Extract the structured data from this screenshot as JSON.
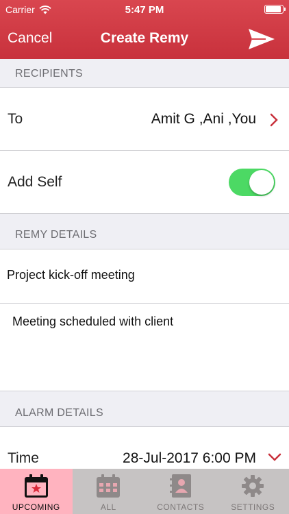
{
  "status": {
    "carrier": "Carrier",
    "time": "5:47 PM"
  },
  "nav": {
    "cancel": "Cancel",
    "title": "Create Remy"
  },
  "sections": {
    "recipients": "RECIPIENTS",
    "details": "REMY DETAILS",
    "alarm": "ALARM DETAILS"
  },
  "recipients": {
    "to_label": "To",
    "to_value": "Amit G ,Ani ,You",
    "self_label": "Add Self",
    "self_on": true
  },
  "details": {
    "title": "Project kick-off meeting",
    "description": "Meeting scheduled with client"
  },
  "alarm": {
    "time_label": "Time",
    "time_value": "28-Jul-2017 6:00 PM"
  },
  "tabs": [
    {
      "label": "UPCOMING",
      "icon": "calendar-star-icon",
      "active": true
    },
    {
      "label": "ALL",
      "icon": "calendar-grid-icon",
      "active": false
    },
    {
      "label": "CONTACTS",
      "icon": "contacts-book-icon",
      "active": false
    },
    {
      "label": "SETTINGS",
      "icon": "gear-icon",
      "active": false
    }
  ],
  "colors": {
    "brand": "#d9464f",
    "toggle": "#4cd964",
    "active_tab": "#ffb3bf",
    "chevron": "#c8313c"
  }
}
